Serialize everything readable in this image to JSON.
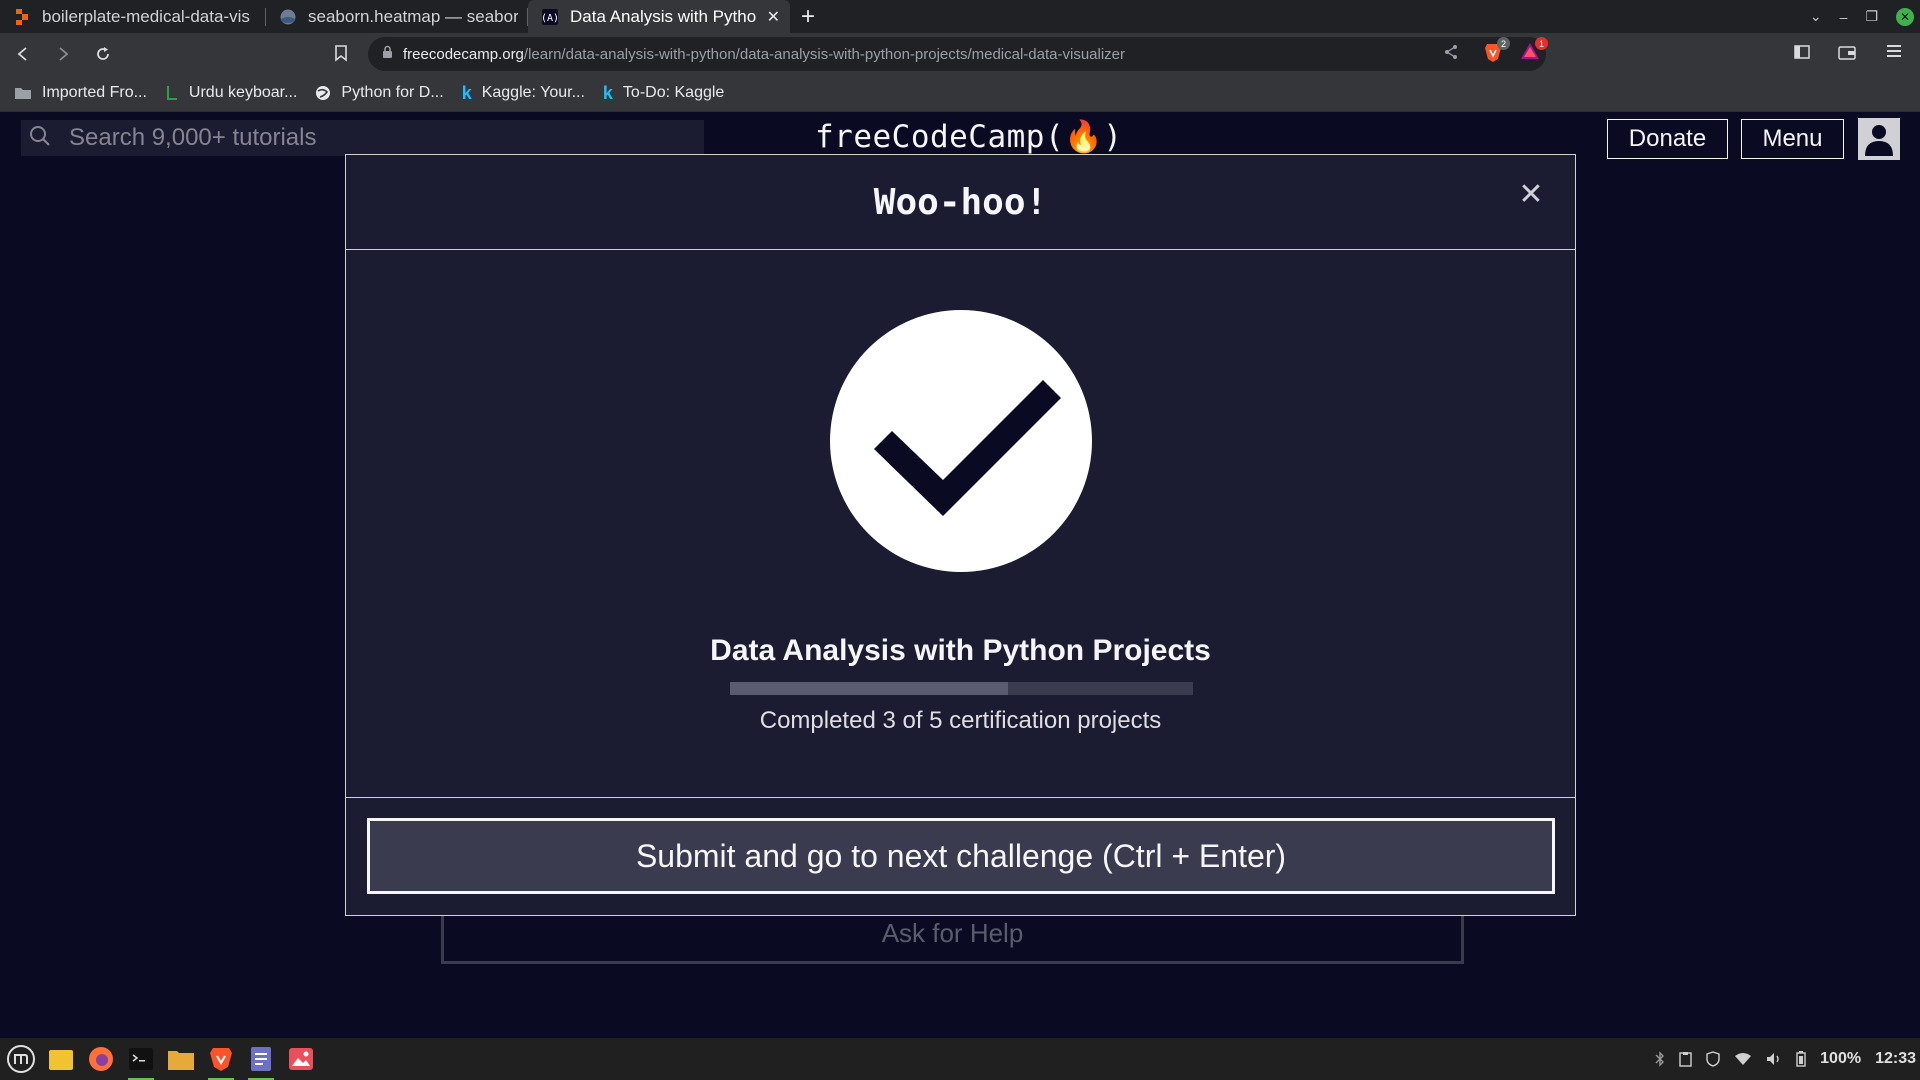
{
  "browser": {
    "tabs": [
      {
        "title": "boilerplate-medical-data-vis",
        "icon": "replit-icon",
        "active": false
      },
      {
        "title": "seaborn.heatmap — seabor",
        "icon": "seaborn-icon",
        "active": false
      },
      {
        "title": "Data Analysis with Pytho",
        "icon": "freecodecamp-icon",
        "active": true
      }
    ],
    "url": {
      "host": "freecodecamp.org",
      "path": "/learn/data-analysis-with-python/data-analysis-with-python-projects/medical-data-visualizer"
    },
    "badges": {
      "brave_shields": "2",
      "rewards": "1"
    },
    "bookmarks": [
      {
        "label": "Imported Fro...",
        "icon": "folder-icon"
      },
      {
        "label": "Urdu keyboar...",
        "icon": "urdu-keyboard-icon"
      },
      {
        "label": "Python for D...",
        "icon": "globe-icon"
      },
      {
        "label": "Kaggle: Your...",
        "icon": "kaggle-icon"
      },
      {
        "label": "To-Do: Kaggle",
        "icon": "kaggle-icon"
      }
    ]
  },
  "fcc": {
    "search_placeholder": "Search 9,000+ tutorials",
    "logo": "freeCodeCamp(🔥)",
    "donate": "Donate",
    "menu": "Menu",
    "ask_help": "Ask for Help"
  },
  "modal": {
    "title": "Woo-hoo!",
    "cert_title": "Data Analysis with Python Projects",
    "progress_text": "Completed 3 of 5 certification projects",
    "progress_completed": 3,
    "progress_total": 5,
    "submit_label": "Submit and go to next challenge (Ctrl + Enter)"
  },
  "taskbar": {
    "battery": "100%",
    "time": "12:33"
  },
  "colors": {
    "page_bg": "#0a0a23",
    "modal_bg": "#1b1b32",
    "button_bg": "#3b3b4f",
    "text": "#f5f6f7"
  }
}
